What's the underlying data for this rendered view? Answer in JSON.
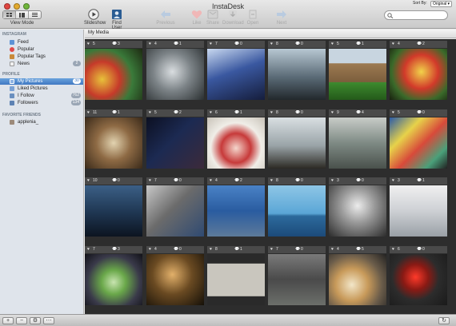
{
  "window": {
    "title": "InstaDesk"
  },
  "toolbar": {
    "view_mode_label": "View Mode",
    "slideshow": "Slideshow",
    "find_user": "Find User",
    "previous": "Previous",
    "like": "Like",
    "share": "Share",
    "download": "Download",
    "open": "Open",
    "next": "Next"
  },
  "search": {
    "value": ""
  },
  "sidebar": {
    "instagram_header": "INSTAGRAM",
    "instagram_items": [
      {
        "label": "Feed",
        "count": ""
      },
      {
        "label": "Popular",
        "count": ""
      },
      {
        "label": "Popular Tags",
        "count": ""
      },
      {
        "label": "News",
        "count": "2"
      }
    ],
    "profile_header": "PROFILE",
    "profile_items": [
      {
        "label": "My Pictures",
        "count": "30"
      },
      {
        "label": "Liked Pictures",
        "count": ""
      },
      {
        "label": "I Follow",
        "count": "762"
      },
      {
        "label": "Followers",
        "count": "134"
      }
    ],
    "friends_header": "FAVORITE FRIENDS",
    "friends_items": [
      {
        "label": "applenia_",
        "count": ""
      }
    ]
  },
  "main": {
    "header": "My Media",
    "sort_label": "Sort By:",
    "sort_value": "Original"
  },
  "photos": [
    {
      "likes": "5",
      "comments": "3"
    },
    {
      "likes": "4",
      "comments": "1"
    },
    {
      "likes": "7",
      "comments": "0"
    },
    {
      "likes": "8",
      "comments": "0"
    },
    {
      "likes": "5",
      "comments": "1"
    },
    {
      "likes": "4",
      "comments": "2"
    },
    {
      "likes": "11",
      "comments": "1"
    },
    {
      "likes": "5",
      "comments": "2"
    },
    {
      "likes": "6",
      "comments": "1"
    },
    {
      "likes": "8",
      "comments": "0"
    },
    {
      "likes": "9",
      "comments": "4"
    },
    {
      "likes": "5",
      "comments": "0"
    },
    {
      "likes": "10",
      "comments": "0"
    },
    {
      "likes": "7",
      "comments": "0"
    },
    {
      "likes": "4",
      "comments": "2"
    },
    {
      "likes": "8",
      "comments": "0"
    },
    {
      "likes": "3",
      "comments": "0"
    },
    {
      "likes": "3",
      "comments": "1"
    },
    {
      "likes": "7",
      "comments": "3"
    },
    {
      "likes": "4",
      "comments": "0"
    },
    {
      "likes": "8",
      "comments": "1"
    },
    {
      "likes": "7",
      "comments": "0"
    },
    {
      "likes": "4",
      "comments": "5"
    },
    {
      "likes": "6",
      "comments": "0"
    }
  ],
  "colors": {
    "accent": "#3f78c2",
    "sidebar_bg": "#dfe4eb",
    "grid_bg": "#2d2d2d"
  }
}
